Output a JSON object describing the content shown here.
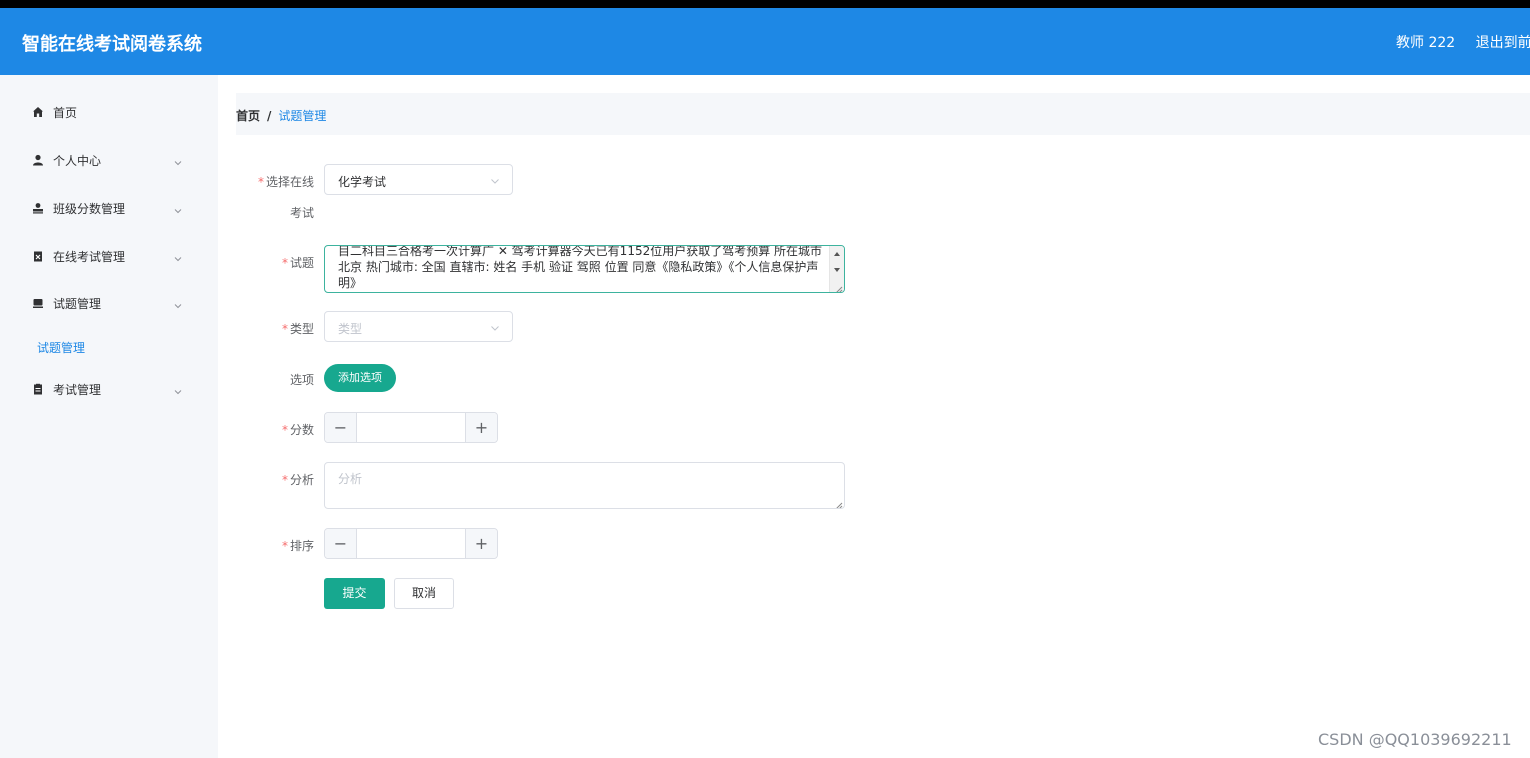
{
  "header": {
    "title": "智能在线考试阅卷系统",
    "user": "教师 222",
    "logout": "退出到前台"
  },
  "sidebar": {
    "items": [
      {
        "label": "首页",
        "icon": "home-icon"
      },
      {
        "label": "个人中心",
        "icon": "user-icon"
      },
      {
        "label": "班级分数管理",
        "icon": "class-icon"
      },
      {
        "label": "在线考试管理",
        "icon": "clipboard-icon"
      },
      {
        "label": "试题管理",
        "icon": "question-icon"
      },
      {
        "label": "考试管理",
        "icon": "exam-icon"
      }
    ],
    "active_sub": "试题管理"
  },
  "breadcrumb": {
    "home": "首页",
    "separator": "/",
    "current": "试题管理"
  },
  "form": {
    "exam_label_1": "选择在线",
    "exam_label_2": "考试",
    "exam_value": "化学考试",
    "question_label": "试题",
    "question_value": "目二科目三合格考一次计算广 ✕ 驾考计算器今天已有1152位用户获取了驾考预算 所在城市北京 热门城市: 全国 直辖市: 姓名 手机 验证 驾照 位置 同意《隐私政策》《个人信息保护声明》",
    "type_label": "类型",
    "type_placeholder": "类型",
    "options_label": "选项",
    "add_option": "添加选项",
    "score_label": "分数",
    "analysis_label": "分析",
    "analysis_placeholder": "分析",
    "order_label": "排序",
    "submit": "提交",
    "cancel": "取消"
  },
  "watermark": "CSDN @QQ1039692211",
  "colors": {
    "header": "#1e88e5",
    "accent": "#17a88f",
    "required": "#f56c6c"
  }
}
